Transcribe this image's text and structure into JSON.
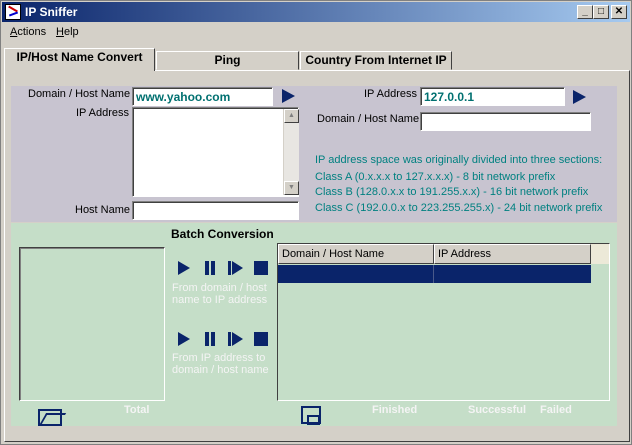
{
  "window": {
    "title": "IP Sniffer",
    "min": "_",
    "max": "□",
    "close": "✕"
  },
  "menu": [
    {
      "label": "Actions",
      "underline": "A",
      "rest": "ctions"
    },
    {
      "label": "Help",
      "underline": "H",
      "rest": "elp"
    }
  ],
  "tabs": [
    "IP/Host Name Convert",
    "Ping",
    "Country From Internet IP"
  ],
  "left": {
    "domain_label": "Domain / Host Name",
    "domain_value": "www.yahoo.com",
    "ip_label": "IP Address",
    "ip_value": "",
    "host_label": "Host Name",
    "host_value": ""
  },
  "right": {
    "ip_label": "IP Address",
    "ip_value": "127.0.0.1",
    "domain_label": "Domain / Host Name",
    "domain_value": "",
    "info": [
      "IP address space was originally divided into three sections:",
      "Class A (0.x.x.x to 127.x.x.x) - 8 bit network prefix",
      "Class B (128.0.x.x to 191.255.x.x) - 16 bit network prefix",
      "Class C (192.0.0.x to 223.255.255.x) - 24 bit network prefix"
    ]
  },
  "batch": {
    "title": "Batch Conversion",
    "hint1": "From domain / host name to IP address",
    "hint2": "From IP address to domain / host name",
    "columns": [
      "Domain / Host Name",
      "IP Address"
    ],
    "total_label": "Total",
    "finished_label": "Finished",
    "successful_label": "Successful",
    "failed_label": "Failed"
  }
}
